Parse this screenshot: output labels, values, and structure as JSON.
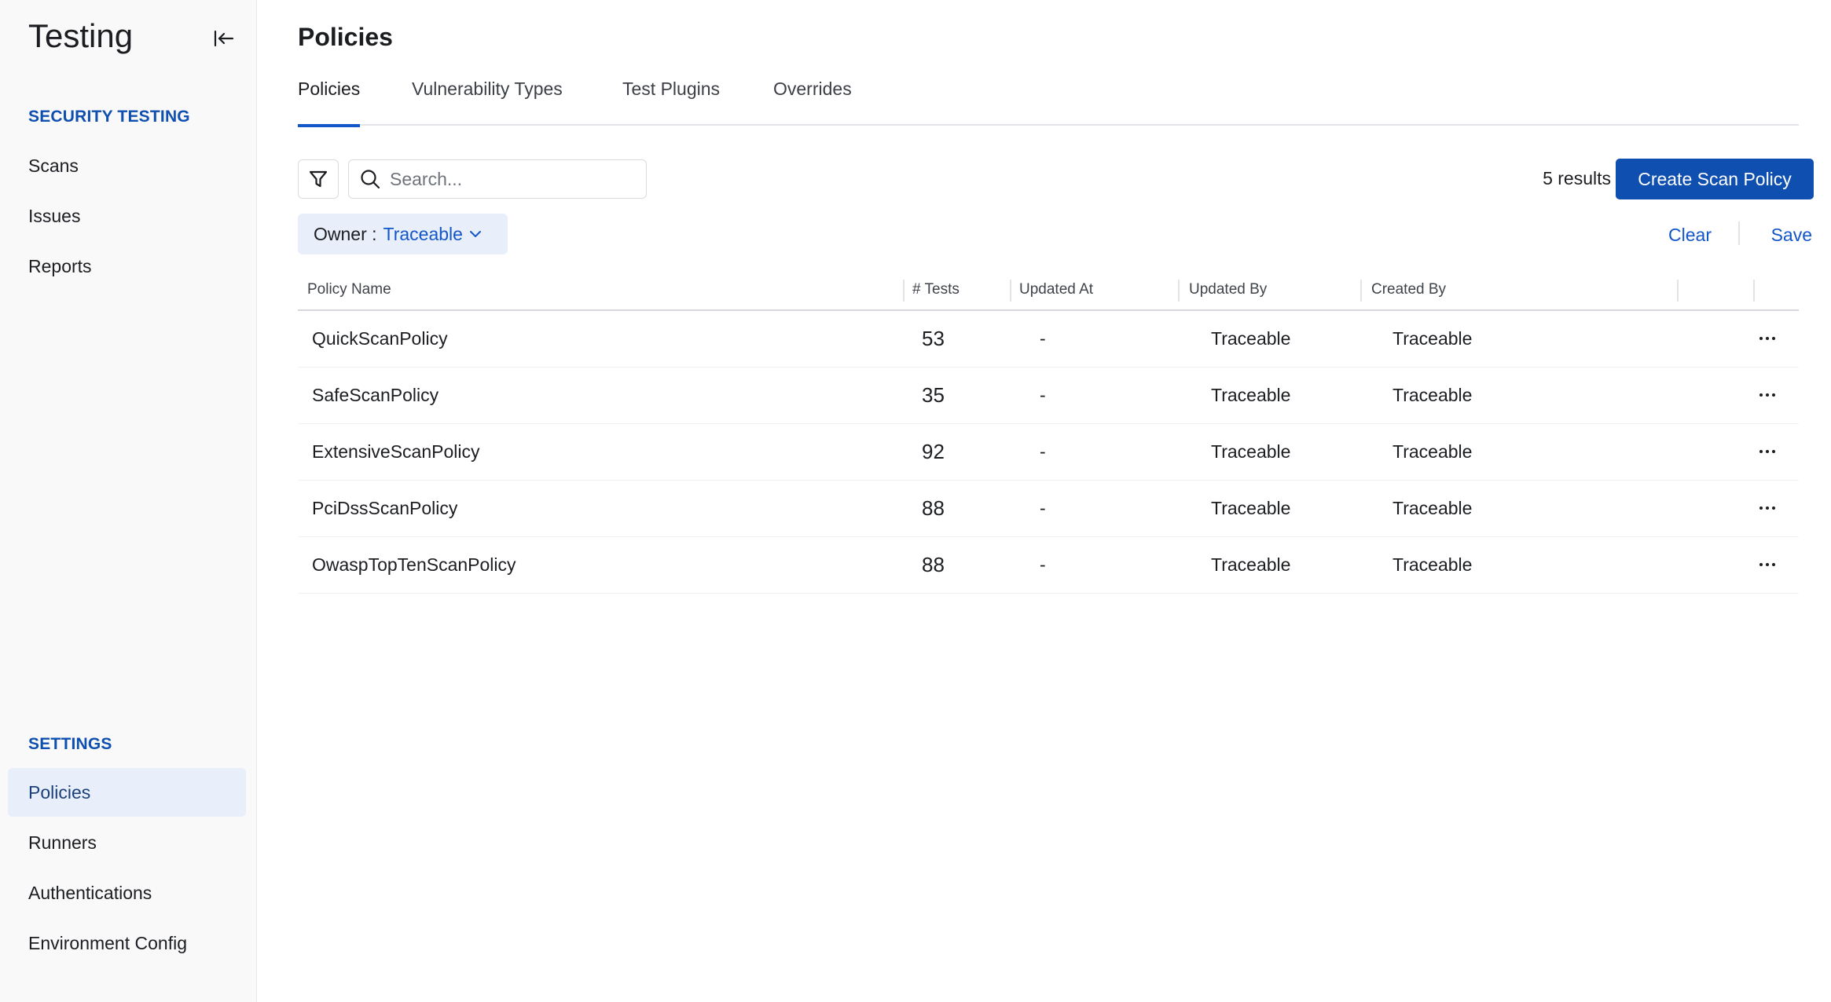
{
  "sidebar": {
    "title": "Testing",
    "collapse_icon": "collapse-left-icon",
    "sections": [
      {
        "label": "SECURITY TESTING",
        "items": [
          {
            "label": "Scans"
          },
          {
            "label": "Issues"
          },
          {
            "label": "Reports"
          }
        ]
      },
      {
        "label": "SETTINGS",
        "items": [
          {
            "label": "Policies",
            "active": true
          },
          {
            "label": "Runners"
          },
          {
            "label": "Authentications"
          },
          {
            "label": "Environment Config"
          }
        ]
      }
    ]
  },
  "main": {
    "title": "Policies",
    "tabs": [
      {
        "label": "Policies",
        "active": true
      },
      {
        "label": "Vulnerability Types"
      },
      {
        "label": "Test Plugins"
      },
      {
        "label": "Overrides"
      }
    ],
    "toolbar": {
      "filter_icon": "filter-icon",
      "search_placeholder": "Search...",
      "search_value": "",
      "results": "5 results",
      "create_label": "Create Scan Policy"
    },
    "filter_chip": {
      "key": "Owner :",
      "value": "Traceable"
    },
    "clear_label": "Clear",
    "save_label": "Save",
    "table": {
      "columns": [
        "Policy Name",
        "# Tests",
        "Updated At",
        "Updated By",
        "Created By"
      ],
      "rows": [
        {
          "name": "QuickScanPolicy",
          "tests": "53",
          "updated_at": "-",
          "updated_by": "Traceable",
          "created_by": "Traceable"
        },
        {
          "name": "SafeScanPolicy",
          "tests": "35",
          "updated_at": "-",
          "updated_by": "Traceable",
          "created_by": "Traceable"
        },
        {
          "name": "ExtensiveScanPolicy",
          "tests": "92",
          "updated_at": "-",
          "updated_by": "Traceable",
          "created_by": "Traceable"
        },
        {
          "name": "PciDssScanPolicy",
          "tests": "88",
          "updated_at": "-",
          "updated_by": "Traceable",
          "created_by": "Traceable"
        },
        {
          "name": "OwaspTopTenScanPolicy",
          "tests": "88",
          "updated_at": "-",
          "updated_by": "Traceable",
          "created_by": "Traceable"
        }
      ]
    }
  },
  "colors": {
    "accent": "#0f4fb0",
    "link": "#1356c7",
    "active_bg": "#e8effb"
  }
}
